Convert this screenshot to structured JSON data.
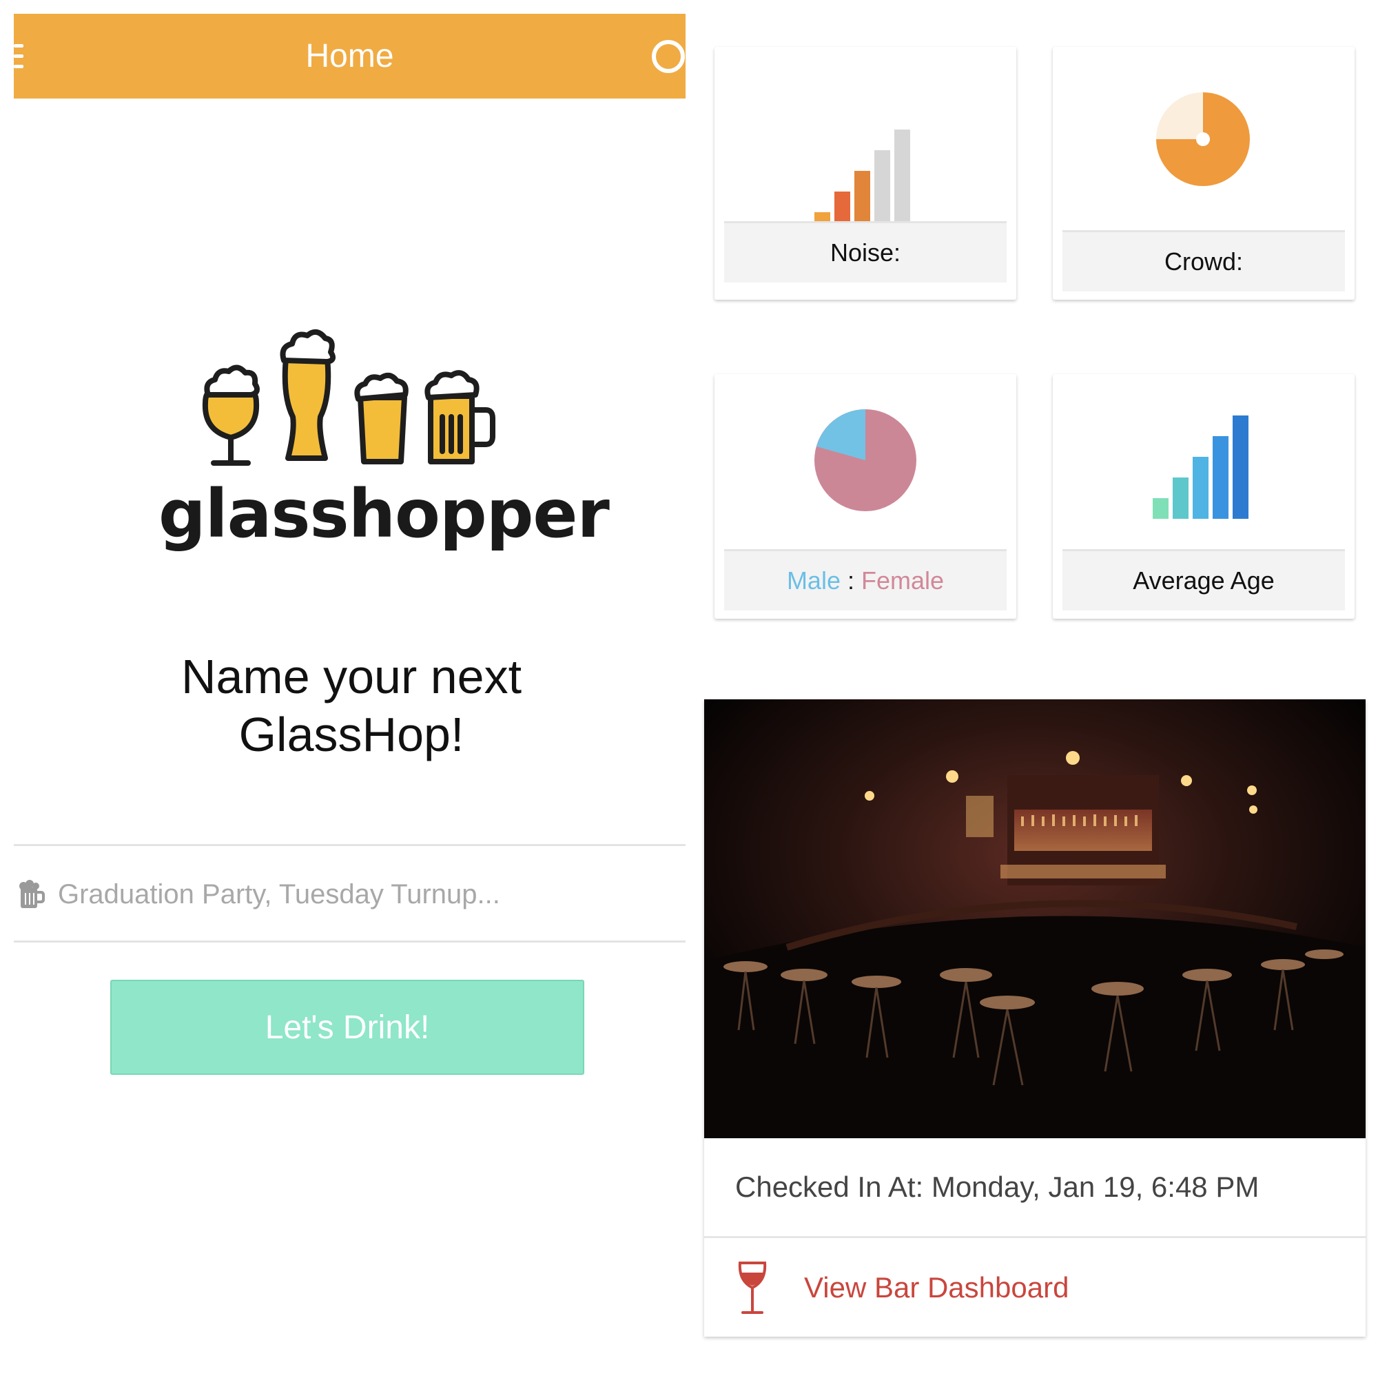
{
  "header": {
    "title": "Home",
    "menu_icon": "hamburger-menu-icon",
    "search_icon": "search-icon",
    "color": "#f0ab43"
  },
  "logo": {
    "wordmark": "glasshopper",
    "icon": "beer-glasses-icon"
  },
  "main": {
    "heading_line1": "Name your next",
    "heading_line2": "GlassHop!",
    "input_placeholder": "Graduation Party, Tuesday Turnup...",
    "input_icon": "beer-mug-icon",
    "cta_label": "Let's Drink!",
    "cta_color": "#8fe6c8"
  },
  "stats": {
    "noise": {
      "label": "Noise:",
      "icon": "signal-bars-icon",
      "level": 0.4
    },
    "crowd": {
      "label": "Crowd:",
      "icon": "pie-chart-icon",
      "fill": 0.8
    },
    "gender": {
      "male_label": "Male",
      "separator": ":",
      "female_label": "Female",
      "male_share": 0.2,
      "male_color": "#6bbfe6",
      "female_color": "#d18899"
    },
    "age": {
      "label": "Average Age",
      "icon": "signal-bars-icon"
    }
  },
  "bar": {
    "photo": "bar-interior-photo",
    "checkin_text": "Checked In At: Monday, Jan 19, 6:48 PM",
    "dashboard_label": "View Bar Dashboard",
    "dashboard_icon": "wine-glass-icon",
    "link_color": "#c9463d"
  }
}
